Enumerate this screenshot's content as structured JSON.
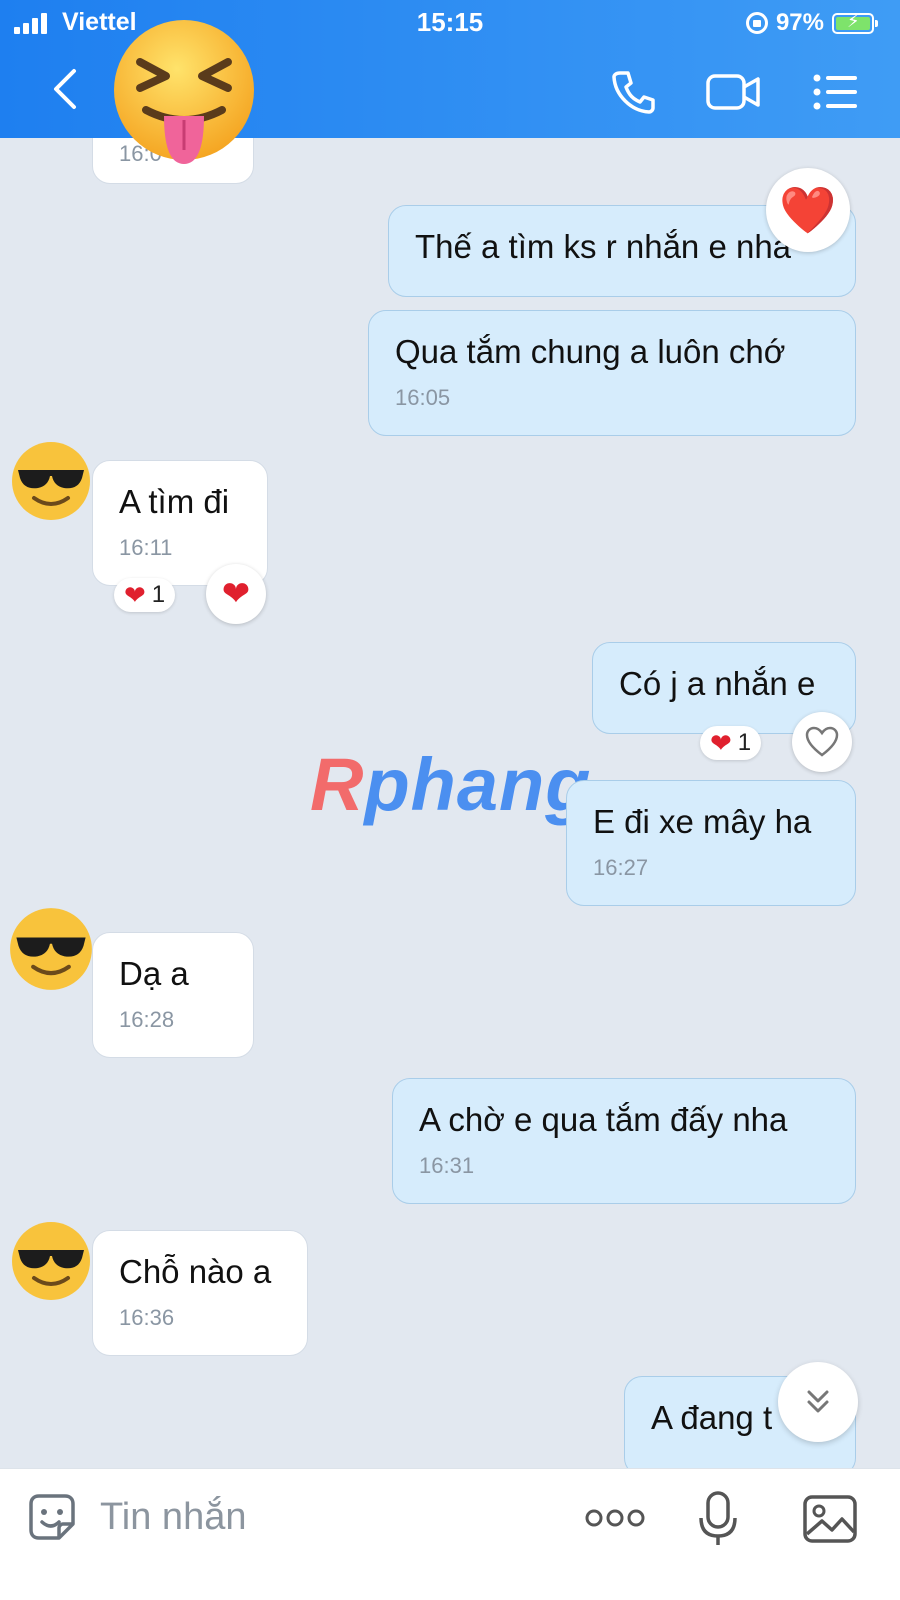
{
  "status_bar": {
    "carrier": "Viettel",
    "time": "15:15",
    "battery": "97%"
  },
  "colors": {
    "header": "#2d8cf3",
    "outgoing_bubble": "#d6ecfc",
    "incoming_bubble": "#ffffff",
    "chat_background": "#e2e8f0"
  },
  "icons": {
    "back": "chevron-left-icon",
    "call": "phone-icon",
    "video": "video-camera-icon",
    "menu": "list-menu-icon",
    "sticker": "sticker-icon",
    "more": "more-dots-icon",
    "mic": "microphone-icon",
    "image": "image-icon"
  },
  "messages": [
    {
      "side": "in",
      "text": "",
      "time": "16:0"
    },
    {
      "side": "out",
      "text": "Thế a tìm ks r nhắn e nha",
      "time": "",
      "reaction": "❤️"
    },
    {
      "side": "out",
      "text": "Qua tắm chung a luôn chớ",
      "time": "16:05"
    },
    {
      "side": "in",
      "text": "A tìm đi",
      "time": "16:11",
      "reaction_count": "1"
    },
    {
      "side": "out",
      "text": "Có j a nhắn e",
      "time": "",
      "reaction_count": "1"
    },
    {
      "side": "out",
      "text": "E đi xe mây ha",
      "time": "16:27"
    },
    {
      "side": "in",
      "text": "Dạ a",
      "time": "16:28"
    },
    {
      "side": "out",
      "text": "A chờ e qua tắm đấy nha",
      "time": "16:31"
    },
    {
      "side": "in",
      "text": "Chỗ nào a",
      "time": "16:36"
    },
    {
      "side": "out",
      "text": "A đang t",
      "time": ""
    }
  ],
  "watermark": {
    "first": "R",
    "rest": "phang"
  },
  "composer": {
    "placeholder": "Tin nhắn"
  }
}
